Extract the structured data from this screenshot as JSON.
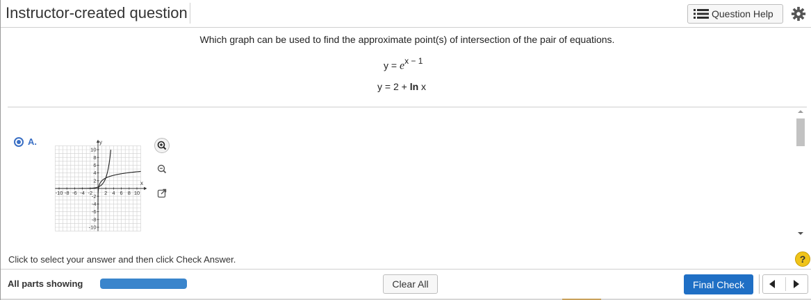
{
  "header": {
    "title": "Instructor-created question",
    "question_help_label": "Question Help",
    "question_help_icon": "list-icon",
    "settings_icon": "gear-icon"
  },
  "question": {
    "prompt": "Which graph can be used to find the approximate point(s) of intersection of the pair of equations.",
    "eq1": {
      "lhs": "y =",
      "base": "e",
      "exponent": "x − 1"
    },
    "eq2": {
      "lhs": "y = 2 +",
      "fn": "ln",
      "arg": "x"
    }
  },
  "choice": {
    "label": "A.",
    "selected": true,
    "graph": {
      "x_label": "x",
      "y_label": "y",
      "x_ticks": [
        "-10",
        "-8",
        "-6",
        "-4",
        "-2",
        "2",
        "4",
        "6",
        "8",
        "10"
      ],
      "y_ticks": [
        "10",
        "8",
        "6",
        "4",
        "2",
        "-2",
        "-4",
        "-6",
        "-8",
        "-10"
      ]
    },
    "tools": {
      "zoom_in_icon": "zoom-in-icon",
      "zoom_out_icon": "zoom-out-icon",
      "popout_icon": "external-link-icon"
    }
  },
  "instruction": "Click to select your answer and then click Check Answer.",
  "help_symbol": "?",
  "footer": {
    "parts_label": "All parts showing",
    "progress": 1.0,
    "clear_all_label": "Clear All",
    "final_check_label": "Final Check",
    "prev_icon": "triangle-left-icon",
    "next_icon": "triangle-right-icon"
  },
  "colors": {
    "accent": "#1f6fc5",
    "radio": "#3a6fc4",
    "progress": "#3a85cc",
    "help": "#f0c419"
  }
}
